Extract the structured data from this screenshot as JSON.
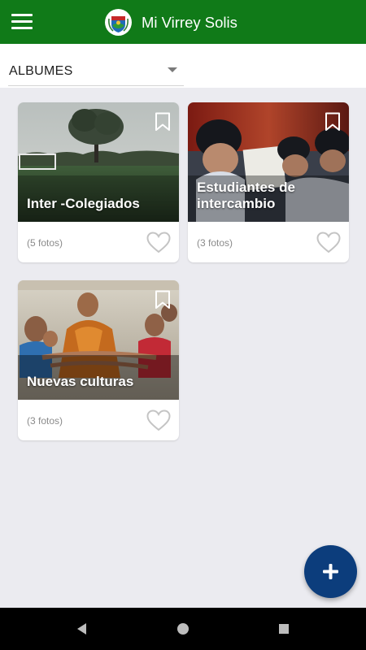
{
  "app": {
    "title": "Mi Virrey Solis",
    "brand_color": "#107a18",
    "fab_color": "#0c3d7c"
  },
  "filter": {
    "selected": "ALBUMES"
  },
  "albums": [
    {
      "title": "Inter -Colegiados",
      "count": "(5 fotos)",
      "image": "soccer-field-photo"
    },
    {
      "title": "Estudiantes de intercambio",
      "count": "(3 fotos)",
      "image": "students-reading-photo"
    },
    {
      "title": "Nuevas culturas",
      "count": "(3 fotos)",
      "image": "monk-with-children-photo"
    }
  ],
  "icons": {
    "menu": "menu-icon",
    "bookmark": "bookmark-outline-icon",
    "heart": "heart-outline-icon",
    "add": "plus-icon",
    "back": "back-triangle-icon",
    "home": "home-circle-icon",
    "recents": "recents-square-icon"
  }
}
